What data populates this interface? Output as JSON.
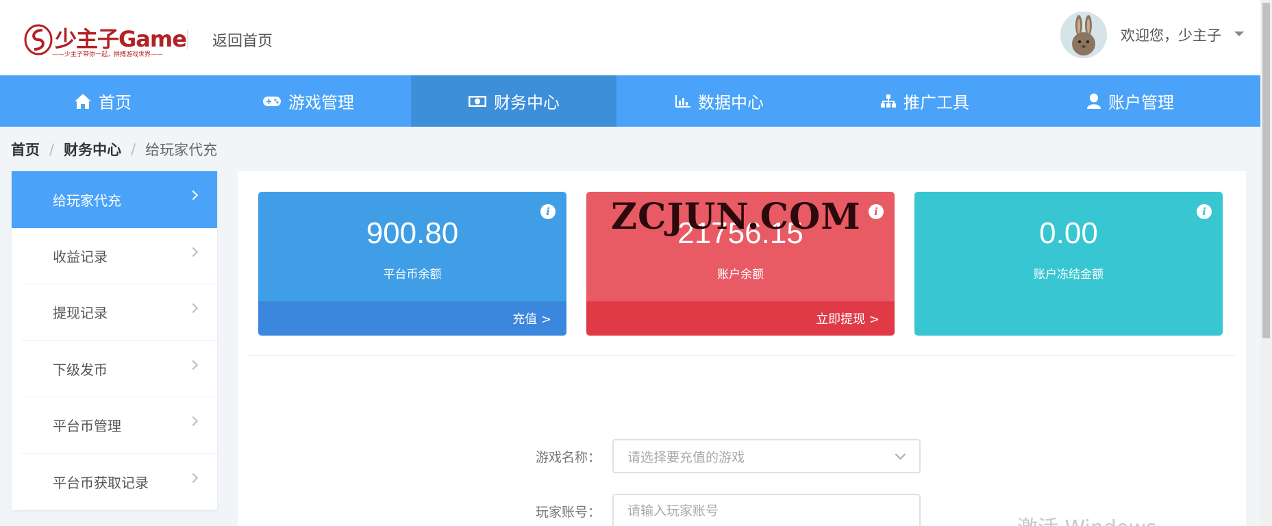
{
  "header": {
    "logo_text": "少主子Game",
    "logo_subtitle": "——少主子带你一起，拼搏游戏世界——",
    "back_home": "返回首页",
    "welcome": "欢迎您，少主子"
  },
  "nav": {
    "items": [
      {
        "label": "首页",
        "icon": "home-icon"
      },
      {
        "label": "游戏管理",
        "icon": "gamepad-icon"
      },
      {
        "label": "财务中心",
        "icon": "money-icon",
        "active": true
      },
      {
        "label": "数据中心",
        "icon": "bar-chart-icon"
      },
      {
        "label": "推广工具",
        "icon": "sitemap-icon"
      },
      {
        "label": "账户管理",
        "icon": "user-icon"
      }
    ]
  },
  "breadcrumb": {
    "home": "首页",
    "separator": "/",
    "finance": "财务中心",
    "current": "给玩家代充"
  },
  "sidebar": {
    "items": [
      {
        "label": "给玩家代充",
        "active": true
      },
      {
        "label": "收益记录"
      },
      {
        "label": "提现记录"
      },
      {
        "label": "下级发币"
      },
      {
        "label": "平台币管理"
      },
      {
        "label": "平台币获取记录"
      }
    ]
  },
  "cards": {
    "platform": {
      "value": "900.80",
      "label": "平台币余额",
      "action": "充值 >",
      "color": "#3f9ee5"
    },
    "account": {
      "value": "21756.15",
      "label": "账户余额",
      "action": "立即提现 >",
      "color": "#e85a64"
    },
    "frozen": {
      "value": "0.00",
      "label": "账户冻结金额",
      "color": "#38c6d3"
    },
    "info_glyph": "i"
  },
  "watermark": "ZCJUN.COM",
  "form": {
    "game_label": "游戏名称：",
    "game_placeholder": "请选择要充值的游戏",
    "account_label": "玩家账号：",
    "account_placeholder": "请输入玩家账号"
  },
  "os_overlay": "激活 Windows",
  "colors": {
    "nav_bg": "#4aa3f8",
    "nav_active": "#3d8fd9",
    "brand": "#b32124"
  }
}
